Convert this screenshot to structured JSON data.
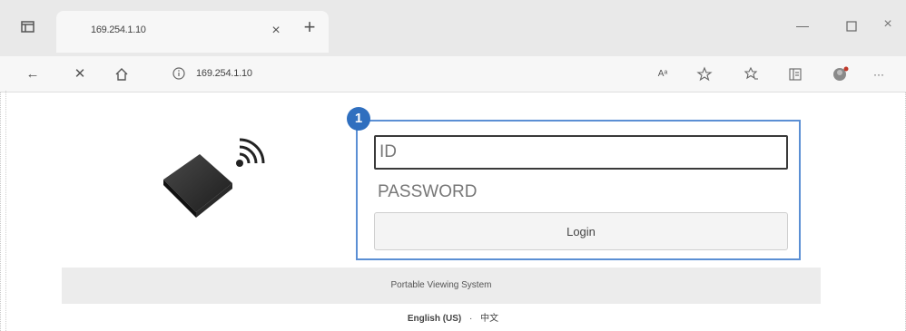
{
  "browser": {
    "tab_title": "169.254.1.10",
    "tab_close": "×",
    "new_tab": "+",
    "address": "169.254.1.10",
    "read_aloud": "Aᵃ",
    "more": "···"
  },
  "login": {
    "marker": "1",
    "id_placeholder": "ID",
    "password_placeholder": "PASSWORD",
    "login_label": "Login"
  },
  "footer": {
    "title": "Portable Viewing System",
    "lang_english": "English (US)",
    "lang_separator": "·",
    "lang_chinese": "中文"
  },
  "colors": {
    "highlight_border": "#5b8fd4",
    "marker_fill": "#2f6fbf"
  }
}
